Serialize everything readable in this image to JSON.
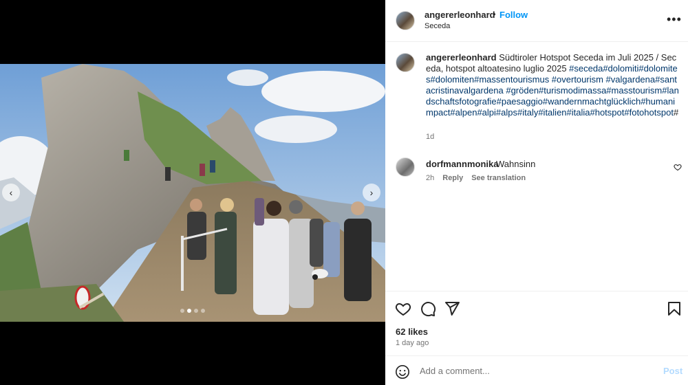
{
  "post": {
    "username": "angererleonhard",
    "separator": "•",
    "follow_label": "Follow",
    "location": "Seceda",
    "more_label": "•••"
  },
  "caption": {
    "username": "angererleonhard",
    "text": " Südtiroler Hotspot Seceda im Juli 2025 / Seceda, hotspot altoatesino luglio 2025 ",
    "hashtags": "#seceda#dolomiti#dolomites#dolomiten#massentourismus #overtourism #valgardena#santacristinavalgardena #gröden#turismodimassa#masstourism#landschaftsfotografie#paesaggio#wandernmachtglücklich#humanimpact#alpen#alpi#alps#italy#italien#italia#hotspot#fotohotspot",
    "trailing": "#",
    "age": "1d"
  },
  "comment": {
    "username": "dorfmannmonika",
    "text": "Wahnsinn",
    "age": "2h",
    "reply_label": "Reply",
    "translate_label": "See translation"
  },
  "stats": {
    "likes": "62 likes",
    "posted": "1 day ago"
  },
  "composer": {
    "placeholder": "Add a comment...",
    "post_label": "Post"
  },
  "carousel": {
    "prev_icon": "‹",
    "next_icon": "›",
    "slide_count": 4,
    "active_slide": 2
  },
  "colors": {
    "link": "#0095f6",
    "hashtag": "#00376b",
    "muted": "#737373",
    "post_disabled": "#b3dbff"
  }
}
